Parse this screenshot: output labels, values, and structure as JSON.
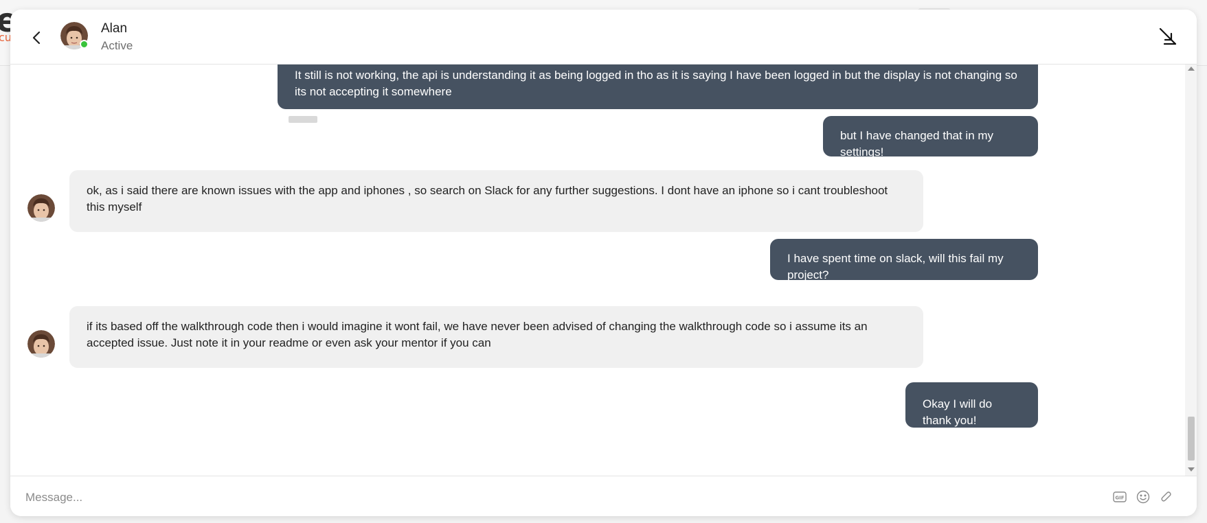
{
  "background": {
    "logo_letter": "e",
    "logo_sub": "cut"
  },
  "header": {
    "name": "Alan",
    "status": "Active",
    "back_icon": "chevron-left-icon",
    "minimize_icon": "minimize-arrow-icon"
  },
  "messages": [
    {
      "from": "me",
      "text": "It still is not working, the api is understanding it as being logged in tho as it is saying I have been logged in but the display is not changing so its not accepting it somewhere"
    },
    {
      "from": "me",
      "text": "but I have changed that in my settings!"
    },
    {
      "from": "Alan",
      "text": "ok, as i said there are known issues with the app and iphones , so search on Slack for any further suggestions. I dont have an iphone so i cant troubleshoot this myself"
    },
    {
      "from": "me",
      "text": "I have spent time on slack, will this fail my project?"
    },
    {
      "from": "Alan",
      "text": "if its based off the walkthrough code then i would imagine it wont fail, we have never been advised of changing the walkthrough code so i assume its an accepted issue. Just note it in your readme or even ask your mentor if you can"
    },
    {
      "from": "me",
      "text": "Okay I will do thank you!"
    }
  ],
  "composer": {
    "placeholder": "Message...",
    "gif_label": "GIF",
    "emoji_icon": "smiley-icon",
    "attach_icon": "paperclip-icon"
  },
  "colors": {
    "outgoing_bubble": "#465261",
    "incoming_bubble": "#f0f0f0",
    "online": "#39c33a"
  }
}
